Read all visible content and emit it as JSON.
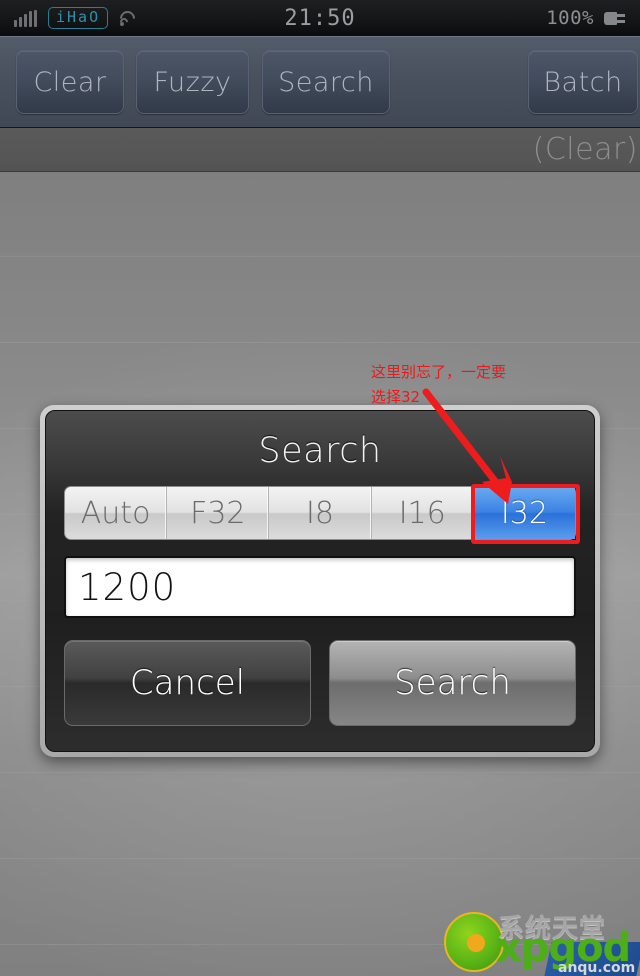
{
  "status_bar": {
    "carrier": "iHaO",
    "clock": "21:50",
    "battery_percent": "100%",
    "icons": {
      "signal": "signal-bars-icon",
      "rss": "rss-icon",
      "plug": "battery-charging-icon"
    }
  },
  "toolbar": {
    "buttons": [
      {
        "label": "Clear"
      },
      {
        "label": "Fuzzy"
      },
      {
        "label": "Search"
      },
      {
        "label": "Batch"
      }
    ]
  },
  "sub_header": {
    "label": "(Clear)"
  },
  "annotation": {
    "text": "这里别忘了，一定要\n选择32",
    "color": "#e81b1b"
  },
  "dialog": {
    "title": "Search",
    "segmented": {
      "options": [
        {
          "label": "Auto",
          "selected": false
        },
        {
          "label": "F32",
          "selected": false
        },
        {
          "label": "I8",
          "selected": false
        },
        {
          "label": "I16",
          "selected": false
        },
        {
          "label": "I32",
          "selected": true
        }
      ],
      "selected_value": "I32",
      "highlight_color": "#ee1c1c",
      "selected_color": "#3b83e4"
    },
    "input": {
      "value": "1200",
      "placeholder": ""
    },
    "actions": {
      "cancel_label": "Cancel",
      "confirm_label": "Search"
    }
  },
  "watermark": {
    "cn_name": "系统天堂",
    "brand": "xpgod",
    "domain": "anqu.com"
  }
}
